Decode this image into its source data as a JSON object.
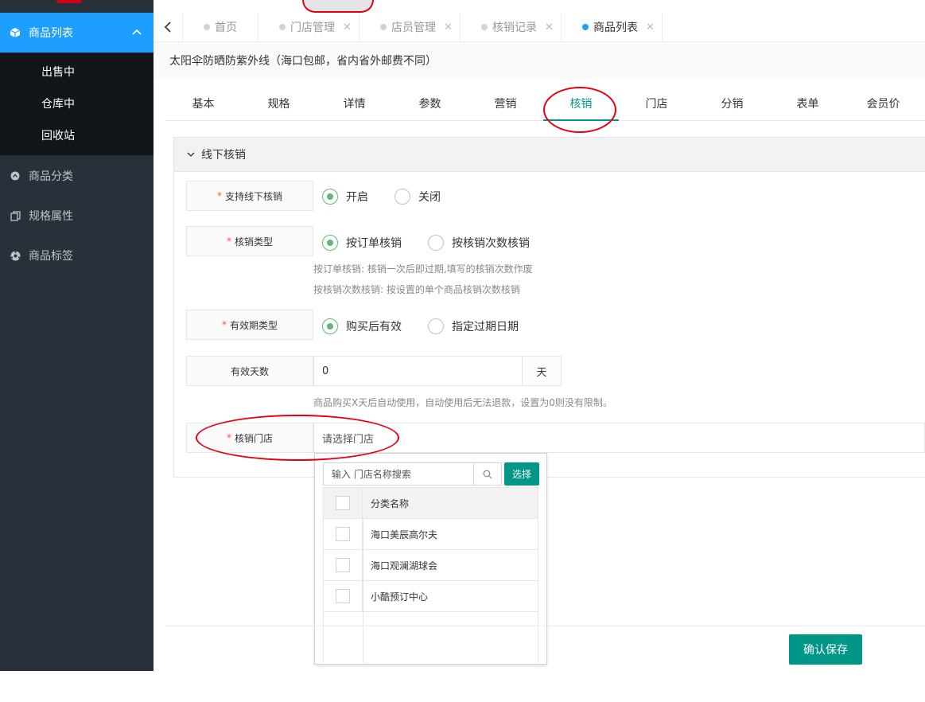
{
  "sidebar": {
    "active_item": "商品列表",
    "sub_items": [
      "出售中",
      "仓库中",
      "回收站"
    ],
    "items": [
      "商品分类",
      "规格属性",
      "商品标签"
    ]
  },
  "page_tabs": [
    {
      "label": "首页",
      "closable": false,
      "active": false
    },
    {
      "label": "门店管理",
      "closable": true,
      "active": false
    },
    {
      "label": "店员管理",
      "closable": true,
      "active": false
    },
    {
      "label": "核销记录",
      "closable": true,
      "active": false
    },
    {
      "label": "商品列表",
      "closable": true,
      "active": true
    }
  ],
  "product_title": "太阳伞防晒防紫外线（海口包邮，省内省外邮费不同）",
  "section_tabs": [
    "基本",
    "规格",
    "详情",
    "参数",
    "营销",
    "核销",
    "门店",
    "分销",
    "表单",
    "会员价"
  ],
  "active_section_tab": "核销",
  "panel": {
    "title": "线下核销",
    "support_offline": {
      "label": "支持线下核销",
      "options": [
        "开启",
        "关闭"
      ],
      "selected": "开启"
    },
    "verify_type": {
      "label": "核销类型",
      "options": [
        "按订单核销",
        "按核销次数核销"
      ],
      "selected": "按订单核销",
      "hint1": "按订单核销: 核销一次后即过期,填写的核销次数作废",
      "hint2": "按核销次数核销: 按设置的单个商品核销次数核销"
    },
    "validity_type": {
      "label": "有效期类型",
      "options": [
        "购买后有效",
        "指定过期日期"
      ],
      "selected": "购买后有效"
    },
    "valid_days": {
      "label": "有效天数",
      "value": "0",
      "suffix": "天",
      "hint": "商品购买X天后自动使用，自动使用后无法退款，设置为0则没有限制。"
    },
    "store": {
      "label": "核销门店",
      "placeholder": "请选择门店"
    }
  },
  "store_dropdown": {
    "search_placeholder": "输入 门店名称搜索",
    "choose_label": "选择",
    "column_header": "分类名称",
    "rows": [
      "海口美辰高尔夫",
      "海口观澜湖球会",
      "小酷预订中心"
    ]
  },
  "save_label": "确认保存",
  "colors": {
    "primary": "#009688",
    "blue": "#1e9fff",
    "radio_on": "#5fb878",
    "required": "#ff5722",
    "annotation": "#e60012"
  }
}
